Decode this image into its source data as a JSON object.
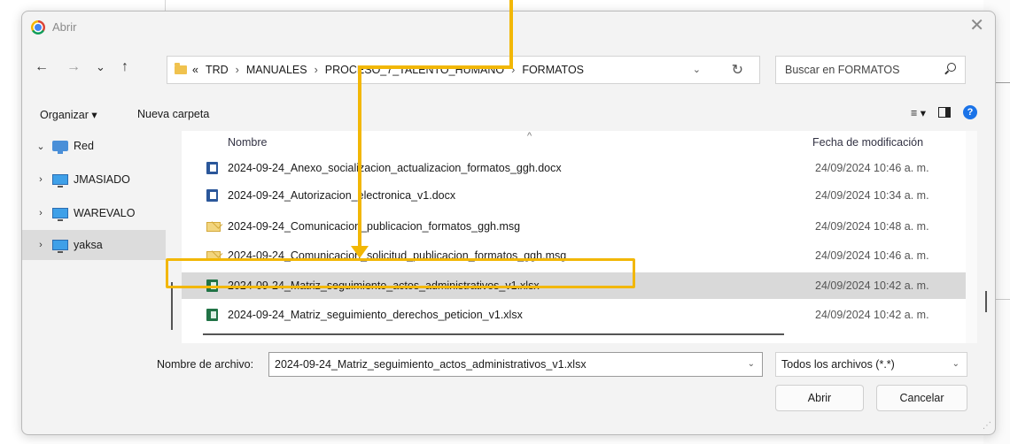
{
  "dialog": {
    "title": "Abrir",
    "close_symbol": "✕"
  },
  "nav": {
    "back": "←",
    "forward": "→",
    "recent": "⌄",
    "up": "↑"
  },
  "address": {
    "overflow": "«",
    "crumbs": [
      "TRD",
      "MANUALES",
      "PROCESO_7_TALENTO_HUMANO",
      "FORMATOS"
    ],
    "separator": "›",
    "dropdown": "⌄",
    "refresh": "↻"
  },
  "search": {
    "placeholder": "Buscar en FORMATOS"
  },
  "commands": {
    "organize": "Organizar ▾",
    "new_folder": "Nueva carpeta",
    "view_menu": "≡ ▾",
    "help": "?"
  },
  "sidebar": {
    "items": [
      {
        "label": "Red",
        "expand": "⌄"
      },
      {
        "label": "JMASIADO",
        "expand": "›"
      },
      {
        "label": "WAREVALO",
        "expand": "›"
      },
      {
        "label": "yaksa",
        "expand": "›"
      }
    ]
  },
  "files": {
    "columns": {
      "name": "Nombre",
      "date": "Fecha de modificación",
      "sort_indicator": "^"
    },
    "rows": [
      {
        "name": "2024-09-24_Anexo_socializacion_actualizacion_formatos_ggh.docx",
        "date": "24/09/2024 10:46 a. m.",
        "type": "word"
      },
      {
        "name": "2024-09-24_Autorizacion_electronica_v1.docx",
        "date": "24/09/2024 10:34 a. m.",
        "type": "word"
      },
      {
        "name": "2024-09-24_Comunicacion_publicacion_formatos_ggh.msg",
        "date": "24/09/2024 10:48 a. m.",
        "type": "msg"
      },
      {
        "name": "2024-09-24_Comunicacion_solicitud_publicacion_formatos_ggh.msg",
        "date": "24/09/2024 10:46 a. m.",
        "type": "msg"
      },
      {
        "name": "2024-09-24_Matriz_seguimiento_actos_administrativos_v1.xlsx",
        "date": "24/09/2024 10:42 a. m.",
        "type": "excel",
        "selected": true
      },
      {
        "name": "2024-09-24_Matriz_seguimiento_derechos_peticion_v1.xlsx",
        "date": "24/09/2024 10:42 a. m.",
        "type": "excel"
      }
    ]
  },
  "footer": {
    "filename_label": "Nombre de archivo:",
    "filename_value": "2024-09-24_Matriz_seguimiento_actos_administrativos_v1.xlsx",
    "filter_value": "Todos los archivos (*.*)",
    "dropdown": "⌄",
    "open_button": "Abrir",
    "cancel_button": "Cancelar"
  },
  "colors": {
    "highlight": "#f2b705",
    "selection": "#d9d9d9",
    "excel": "#217346",
    "word": "#2b579a"
  }
}
